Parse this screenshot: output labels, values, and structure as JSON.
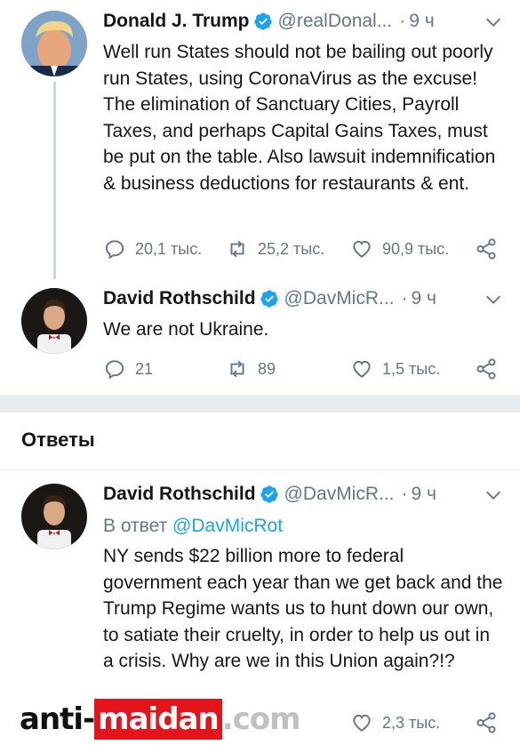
{
  "tweets": [
    {
      "name": "Donald J. Trump",
      "handle": "@realDonal...",
      "dot": "·",
      "time": "9 ч",
      "text": "Well run States should not be bailing out poorly run States, using CoronaVirus as the excuse! The elimination of Sanctuary Cities, Payroll Taxes, and perhaps Capital Gains Taxes, must be put on the table. Also lawsuit indemnification & business deductions for restaurants & ent.",
      "replies": "20,1 тыс.",
      "retweets": "25,2 тыс.",
      "likes": "90,9 тыс."
    },
    {
      "name": "David Rothschild",
      "handle": "@DavMicR...",
      "dot": "·",
      "time": "9 ч",
      "text": "We are not Ukraine.",
      "replies": "21",
      "retweets": "89",
      "likes": "1,5 тыс."
    }
  ],
  "replies_section": {
    "title": "Ответы"
  },
  "reply": {
    "name": "David Rothschild",
    "handle": "@DavMicR...",
    "dot": "·",
    "time": "9 ч",
    "reply_prefix": "В ответ",
    "reply_mention": "@DavMicRot",
    "text": "NY sends $22 billion more to federal government each year than we get back and the Trump Regime wants us to hunt down our own, to satiate their cruelty, in order to help us out in a crisis. Why are we in this Union again?!?",
    "likes": "2,3 тыс."
  },
  "watermark": {
    "part1": "anti-",
    "part2": "maidan",
    "part3": ".com"
  },
  "colors": {
    "accent": "#1da1f2",
    "muted": "#657786",
    "watermark_red": "#e3141b"
  },
  "icons": [
    "reply-icon",
    "retweet-icon",
    "like-icon",
    "share-icon",
    "verified-icon",
    "chevron-down-icon"
  ]
}
